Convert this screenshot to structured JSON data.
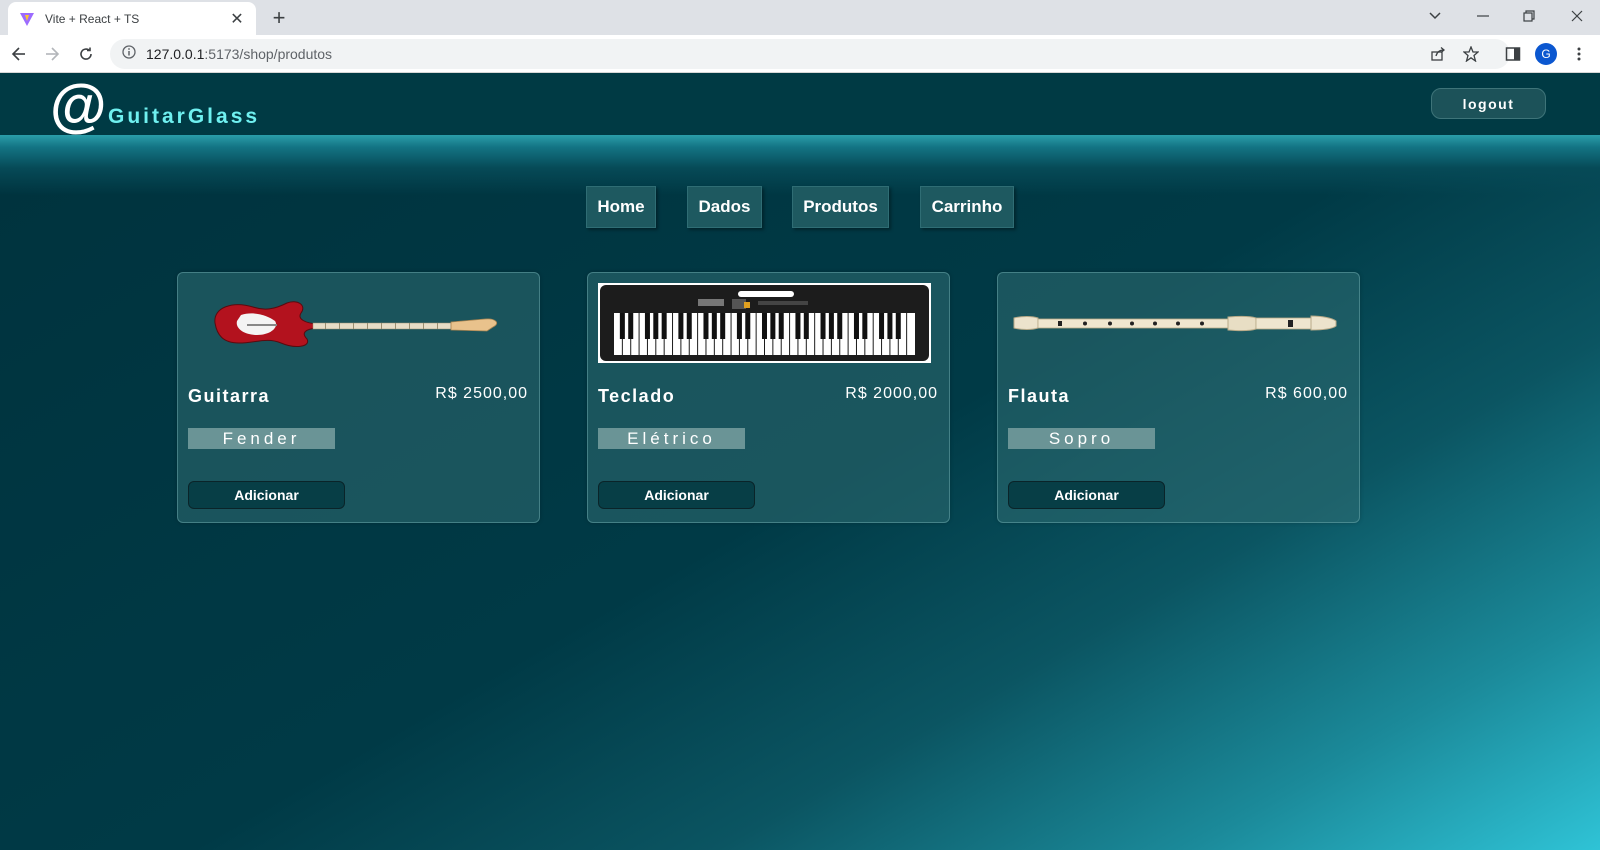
{
  "browser": {
    "tab_title": "Vite + React + TS",
    "url_host": "127.0.0.1",
    "url_rest": ":5173/shop/produtos",
    "profile_initial": "G"
  },
  "header": {
    "logo_symbol": "@",
    "logo_text": "GuitarGlass",
    "logout_label": "logout"
  },
  "nav": {
    "items": [
      {
        "label": "Home"
      },
      {
        "label": "Dados"
      },
      {
        "label": "Produtos"
      },
      {
        "label": "Carrinho"
      }
    ]
  },
  "products": [
    {
      "name": "Guitarra",
      "price": "R$ 2500,00",
      "brand": "Fender",
      "button": "Adicionar",
      "image_icon": "electric-guitar-icon"
    },
    {
      "name": "Teclado",
      "price": "R$ 2000,00",
      "brand": "Elétrico",
      "button": "Adicionar",
      "image_icon": "keyboard-icon"
    },
    {
      "name": "Flauta",
      "price": "R$ 600,00",
      "brand": "Sopro",
      "button": "Adicionar",
      "image_icon": "recorder-flute-icon"
    }
  ]
}
